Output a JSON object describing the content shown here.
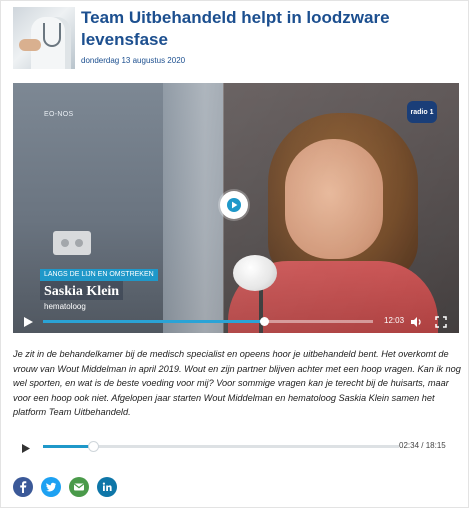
{
  "article": {
    "title": "Team Uitbehandeld helpt in loodzware levensfase",
    "date": "donderdag 13 augustus 2020"
  },
  "video": {
    "source_label": "EO-NOS",
    "channel_logo_text": "radio 1",
    "lower_third": {
      "category": "LANGS DE LIJN EN OMSTREKEN",
      "name": "Saskia Klein",
      "role": "hematoloog"
    },
    "time_remaining": "12:03",
    "progress": 0.67
  },
  "body": {
    "text": "Je zit in de behandelkamer bij de medisch specialist en opeens hoor je uitbehandeld bent. Het overkomt de vrouw van Wout Middelman in april 2019. Wout en zijn partner blijven achter met een hoop vragen. Kan ik nog wel sporten, en wat is de beste voeding voor mij? Voor sommige vragen kan je terecht bij de huisarts, maar voor een hoop ook niet. Afgelopen jaar starten Wout Middelman en hematoloog Saskia Klein samen het platform Team Uitbehandeld."
  },
  "audio": {
    "current": "02:34",
    "separator": "/",
    "duration": "18:15",
    "progress": 0.14
  },
  "share": {
    "buttons": [
      {
        "name": "facebook",
        "icon": "facebook-icon",
        "color": "#3b5998"
      },
      {
        "name": "twitter",
        "icon": "twitter-icon",
        "color": "#1da1f2"
      },
      {
        "name": "email",
        "icon": "mail-icon",
        "color": "#4a9a4a"
      },
      {
        "name": "linkedin",
        "icon": "linkedin-icon",
        "color": "#0e76a8"
      }
    ]
  },
  "colors": {
    "title": "#1c4f8f",
    "accent": "#1f98c9"
  }
}
